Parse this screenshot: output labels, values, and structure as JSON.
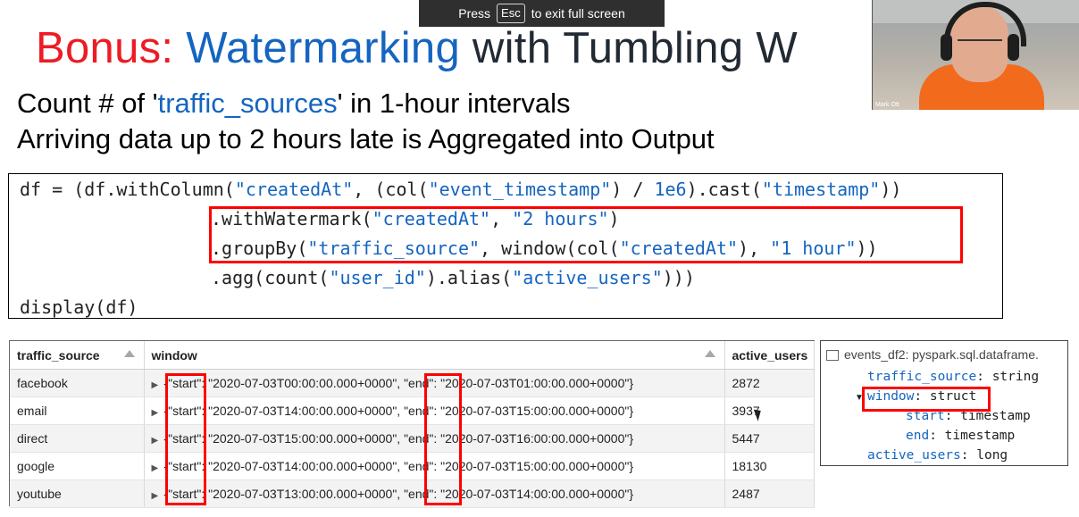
{
  "fullscreen_notice": {
    "press": "Press",
    "key": "Esc",
    "rest": "to exit full screen"
  },
  "title": {
    "part1": "Bonus: ",
    "part2": "Watermarking",
    "part3": " with Tumbling W"
  },
  "webcam": {
    "name": "Mark Ott"
  },
  "subtitle": {
    "line1_pre": "Count # of '",
    "line1_term": "traffic_sources",
    "line1_post": "' in 1-hour intervals",
    "line2": "Arriving data up to 2 hours late is Aggregated into Output"
  },
  "code": {
    "line1": [
      {
        "t": "df = (df.withColumn(",
        "c": "plain"
      },
      {
        "t": "\"createdAt\"",
        "c": "str"
      },
      {
        "t": ", (col(",
        "c": "plain"
      },
      {
        "t": "\"event_timestamp\"",
        "c": "str"
      },
      {
        "t": ") / ",
        "c": "plain"
      },
      {
        "t": "1e6",
        "c": "str"
      },
      {
        "t": ").cast(",
        "c": "plain"
      },
      {
        "t": "\"timestamp\"",
        "c": "str"
      },
      {
        "t": "))",
        "c": "plain"
      }
    ],
    "line2": [
      {
        "t": ".withWatermark(",
        "c": "plain"
      },
      {
        "t": "\"createdAt\"",
        "c": "str"
      },
      {
        "t": ", ",
        "c": "plain"
      },
      {
        "t": "\"2 hours\"",
        "c": "str"
      },
      {
        "t": ")",
        "c": "plain"
      }
    ],
    "line3": [
      {
        "t": ".groupBy(",
        "c": "plain"
      },
      {
        "t": "\"traffic_source\"",
        "c": "str"
      },
      {
        "t": ", window(col(",
        "c": "plain"
      },
      {
        "t": "\"createdAt\"",
        "c": "str"
      },
      {
        "t": "), ",
        "c": "plain"
      },
      {
        "t": "\"1 hour\"",
        "c": "str"
      },
      {
        "t": "))",
        "c": "plain"
      }
    ],
    "line4": [
      {
        "t": ".agg(count(",
        "c": "plain"
      },
      {
        "t": "\"user_id\"",
        "c": "str"
      },
      {
        "t": ").alias(",
        "c": "plain"
      },
      {
        "t": "\"active_users\"",
        "c": "str"
      },
      {
        "t": ")))",
        "c": "plain"
      }
    ],
    "line5": [
      {
        "t": "display(df)",
        "c": "plain"
      }
    ]
  },
  "table": {
    "columns": [
      "traffic_source",
      "window",
      "active_users"
    ],
    "rows": [
      {
        "traffic_source": "facebook",
        "start": "2020-07-03T00:00:00.000+0000",
        "end": "2020-07-03T01:00:00.000+0000",
        "active_users": "2872"
      },
      {
        "traffic_source": "email",
        "start": "2020-07-03T14:00:00.000+0000",
        "end": "2020-07-03T15:00:00.000+0000",
        "active_users": "3937"
      },
      {
        "traffic_source": "direct",
        "start": "2020-07-03T15:00:00.000+0000",
        "end": "2020-07-03T16:00:00.000+0000",
        "active_users": "5447"
      },
      {
        "traffic_source": "google",
        "start": "2020-07-03T14:00:00.000+0000",
        "end": "2020-07-03T15:00:00.000+0000",
        "active_users": "18130"
      },
      {
        "traffic_source": "youtube",
        "start": "2020-07-03T13:00:00.000+0000",
        "end": "2020-07-03T14:00:00.000+0000",
        "active_users": "2487"
      }
    ]
  },
  "schema": {
    "header": "events_df2:  pyspark.sql.dataframe.",
    "fields": [
      {
        "key": "traffic_source",
        "type": "string"
      },
      {
        "key": "window",
        "type": "struct"
      },
      {
        "key": "start",
        "type": "timestamp"
      },
      {
        "key": "end",
        "type": "timestamp"
      },
      {
        "key": "active_users",
        "type": "long"
      }
    ]
  },
  "colors": {
    "title_red": "#ec1c24",
    "title_blue": "#1565c0",
    "highlight_frame": "#ff0000",
    "code_string": "#1565c0"
  }
}
